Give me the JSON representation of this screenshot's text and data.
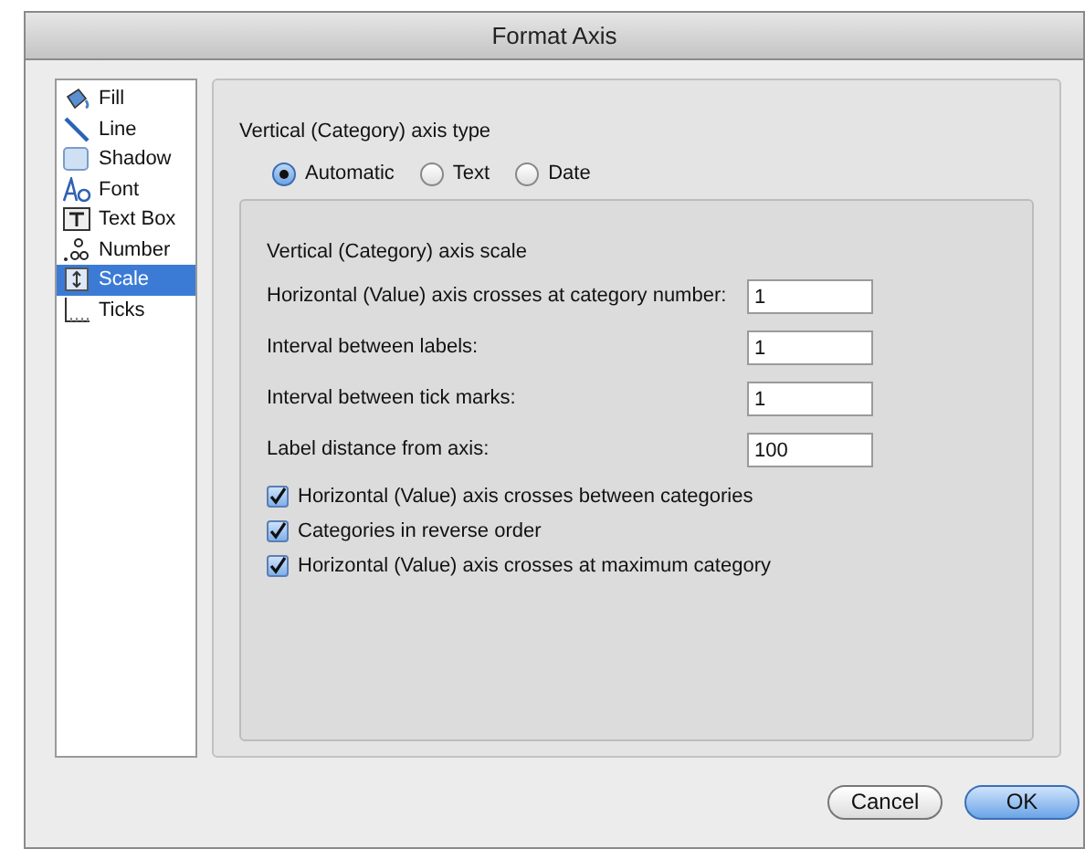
{
  "window": {
    "title": "Format Axis"
  },
  "sidebar": {
    "items": [
      {
        "label": "Fill",
        "selected": false
      },
      {
        "label": "Line",
        "selected": false
      },
      {
        "label": "Shadow",
        "selected": false
      },
      {
        "label": "Font",
        "selected": false
      },
      {
        "label": "Text Box",
        "selected": false
      },
      {
        "label": "Number",
        "selected": false
      },
      {
        "label": "Scale",
        "selected": true
      },
      {
        "label": "Ticks",
        "selected": false
      }
    ]
  },
  "axis_type": {
    "heading": "Vertical (Category) axis type",
    "options": [
      {
        "label": "Automatic",
        "selected": true
      },
      {
        "label": "Text",
        "selected": false
      },
      {
        "label": "Date",
        "selected": false
      }
    ]
  },
  "scale": {
    "heading": "Vertical (Category) axis scale",
    "fields": [
      {
        "label": "Horizontal (Value) axis crosses at category number:",
        "value": "1"
      },
      {
        "label": "Interval between labels:",
        "value": "1"
      },
      {
        "label": "Interval between tick marks:",
        "value": "1"
      },
      {
        "label": "Label distance from axis:",
        "value": "100"
      }
    ],
    "checkboxes": [
      {
        "label": "Horizontal (Value) axis crosses between categories",
        "checked": true
      },
      {
        "label": "Categories in reverse order",
        "checked": true
      },
      {
        "label": "Horizontal (Value) axis crosses at maximum category",
        "checked": true
      }
    ]
  },
  "buttons": [
    {
      "label": "Cancel",
      "kind": "secondary"
    },
    {
      "label": "OK",
      "kind": "primary"
    }
  ]
}
